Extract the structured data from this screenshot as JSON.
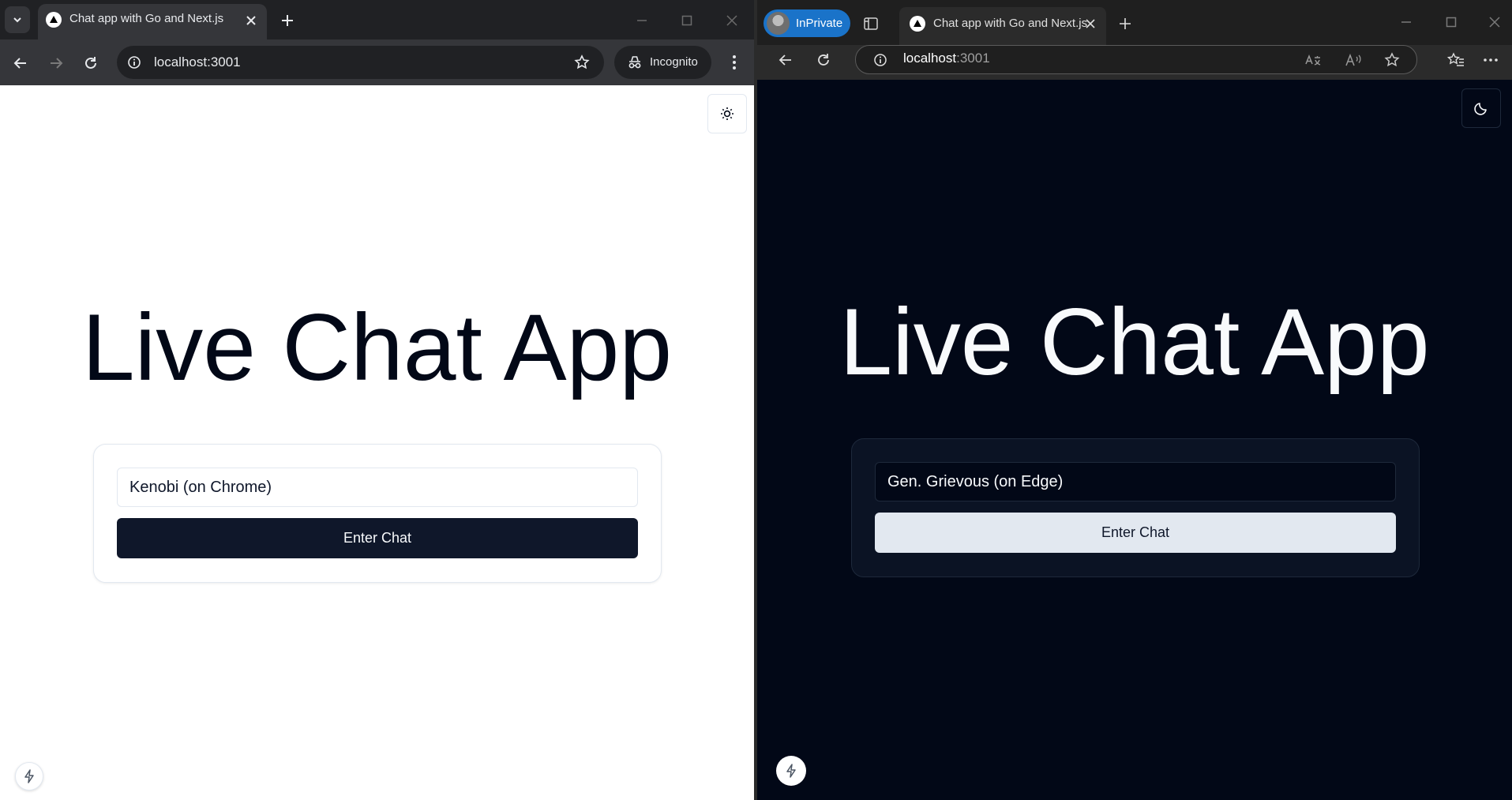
{
  "chrome_window": {
    "tab_title": "Chat app with Go and Next.js",
    "url": "localhost:3001",
    "incognito_label": "Incognito",
    "page": {
      "heading": "Live Chat App",
      "name_input_value": "Kenobi (on Chrome)",
      "enter_button_label": "Enter Chat",
      "theme": "light",
      "theme_toggle_icon": "sun-icon"
    }
  },
  "edge_window": {
    "inprivate_label": "InPrivate",
    "tab_title": "Chat app with Go and Next.js",
    "url_host": "localhost",
    "url_port": ":3001",
    "page": {
      "heading": "Live Chat App",
      "name_input_value": "Gen. Grievous (on Edge)",
      "enter_button_label": "Enter Chat",
      "theme": "dark",
      "theme_toggle_icon": "moon-icon"
    }
  },
  "colors": {
    "light_background": "#ffffff",
    "light_text": "#020817",
    "light_button_bg": "#0f172a",
    "dark_background": "#020817",
    "dark_text": "#f8fafc",
    "dark_button_bg": "#e2e8f0",
    "inprivate_badge": "#1a73c9"
  }
}
